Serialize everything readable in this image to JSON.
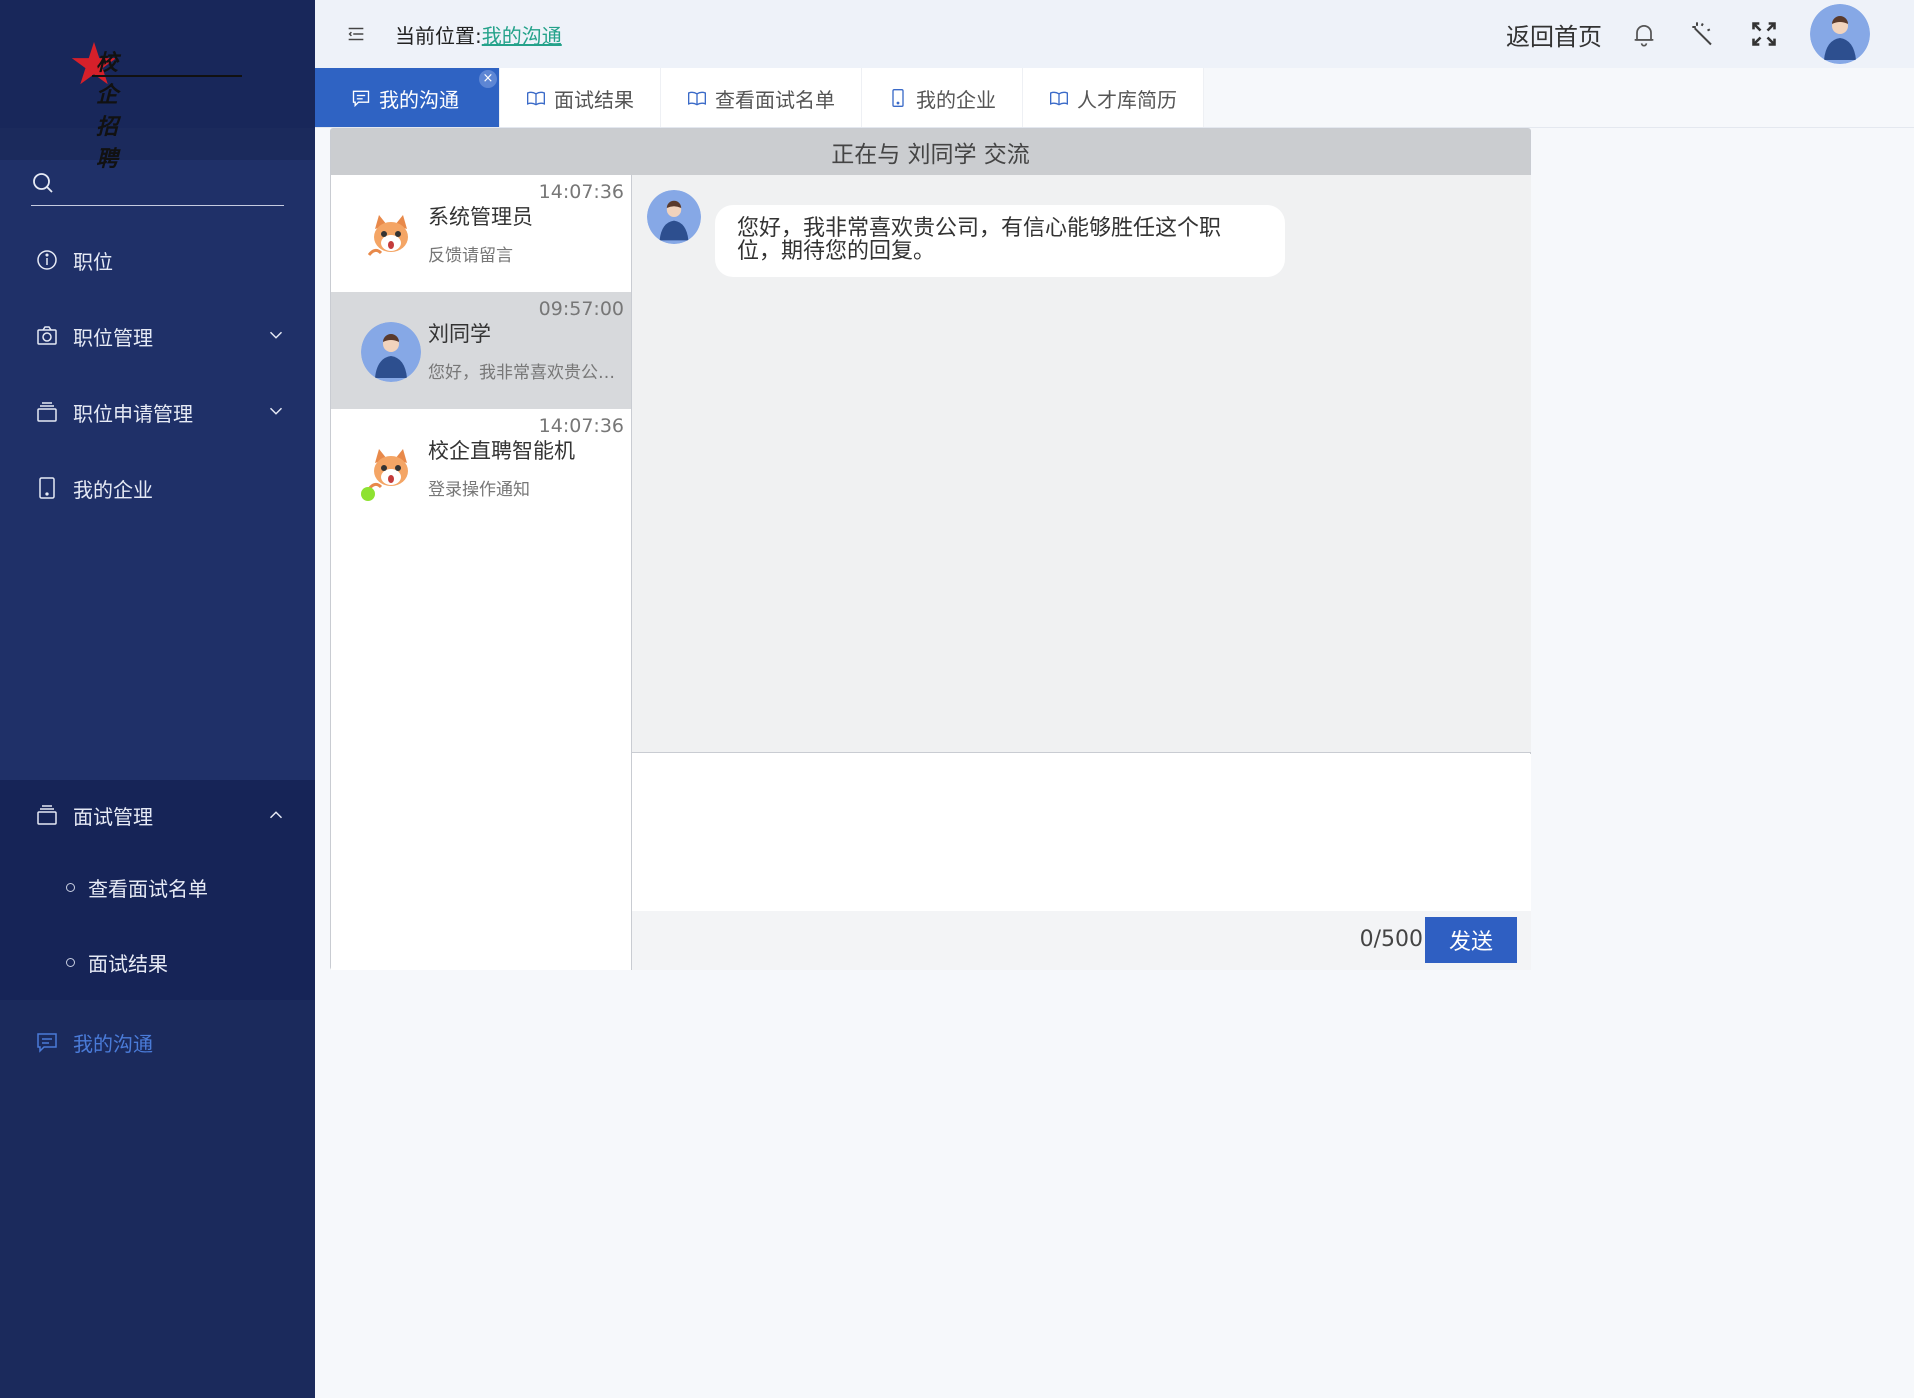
{
  "logo": {
    "text": "校企招聘"
  },
  "search": {
    "placeholder": ""
  },
  "sidebar": {
    "items": [
      {
        "label": "职位"
      },
      {
        "label": "职位管理"
      },
      {
        "label": "职位申请管理"
      },
      {
        "label": "我的企业"
      },
      {
        "label": "面试管理"
      }
    ],
    "sub_items": [
      {
        "label": "查看面试名单"
      },
      {
        "label": "面试结果"
      }
    ],
    "active": {
      "label": "我的沟通"
    }
  },
  "header": {
    "crumb_prefix": "当前位置:",
    "crumb_link": "我的沟通",
    "home_label": "返回首页"
  },
  "tabs": [
    {
      "label": "我的沟通",
      "close": "×"
    },
    {
      "label": "面试结果"
    },
    {
      "label": "查看面试名单"
    },
    {
      "label": "我的企业"
    },
    {
      "label": "人才库简历"
    }
  ],
  "chat": {
    "title": "正在与 刘同学 交流",
    "contacts": [
      {
        "name": "系统管理员",
        "time": "14:07:36",
        "preview": "反馈请留言"
      },
      {
        "name": "刘同学",
        "time": "09:57:00",
        "preview": "您好，我非常喜欢贵公司，有信心能够胜任这个职位，期待您的回复。"
      },
      {
        "name": "校企直聘智能机",
        "time": "14:07:36",
        "preview": "登录操作通知"
      }
    ],
    "message": "您好，我非常喜欢贵公司，有信心能够胜任这个职位，期待您的回复。",
    "counter": "0/500",
    "send_label": "发送"
  }
}
